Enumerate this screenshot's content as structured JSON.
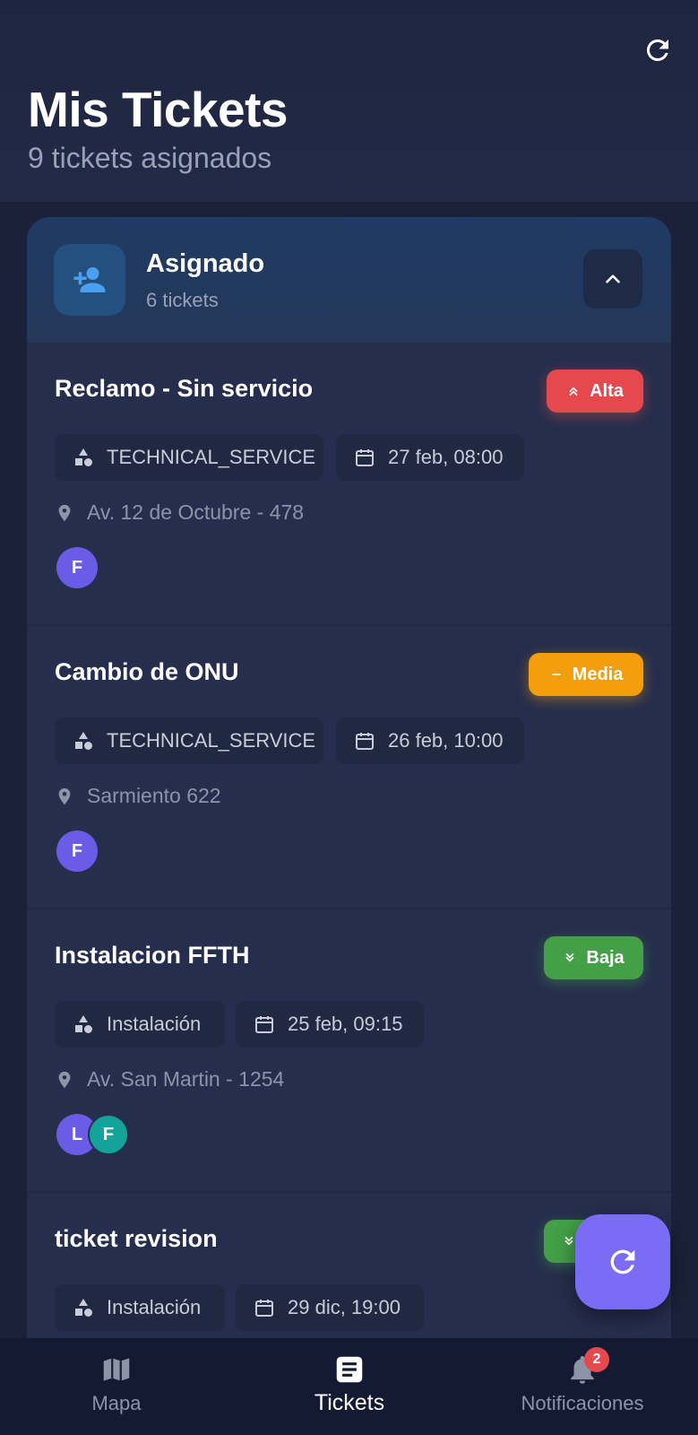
{
  "header": {
    "title": "Mis Tickets",
    "subtitle": "9 tickets asignados",
    "refresh_icon": "refresh-icon"
  },
  "group": {
    "title": "Asignado",
    "count": "6 tickets",
    "icon": "person-add-icon",
    "toggle_icon": "chevron-up-icon"
  },
  "tickets": [
    {
      "title": "Reclamo - Sin servicio",
      "priority": "Alta",
      "priority_icon": "double-chevron-up-icon",
      "priority_color": "#e5484d",
      "category": "TECHNICAL_SERVICE",
      "date": "27 feb, 08:00",
      "location": "Av. 12 de Octubre - 478",
      "avatars": [
        "F"
      ]
    },
    {
      "title": "Cambio de ONU",
      "priority": "Media",
      "priority_icon": "minus-icon",
      "priority_color": "#f59e0b",
      "category": "TECHNICAL_SERVICE",
      "date": "26 feb, 10:00",
      "location": "Sarmiento 622",
      "avatars": [
        "F"
      ]
    },
    {
      "title": "Instalacion FFTH",
      "priority": "Baja",
      "priority_icon": "double-chevron-down-icon",
      "priority_color": "#43a047",
      "category": "Instalación",
      "date": "25 feb, 09:15",
      "location": "Av. San Martin - 1254",
      "avatars": [
        "L",
        "F"
      ]
    },
    {
      "title": "ticket revision",
      "priority": "",
      "priority_icon": "double-chevron-down-icon",
      "priority_color": "#43a047",
      "category": "Instalación",
      "date": "29 dic, 19:00"
    }
  ],
  "fab": {
    "icon": "refresh-icon"
  },
  "nav": {
    "items": [
      {
        "label": "Mapa",
        "icon": "map-icon"
      },
      {
        "label": "Tickets",
        "icon": "document-icon",
        "active": true
      },
      {
        "label": "Notificaciones",
        "icon": "bell-icon"
      }
    ],
    "notification_badge": "2"
  },
  "colors": {
    "background": "#1b2138",
    "card": "#262e4d",
    "accent": "#7b6cf6",
    "alta": "#e5484d",
    "media": "#f59e0b",
    "baja": "#43a047"
  }
}
